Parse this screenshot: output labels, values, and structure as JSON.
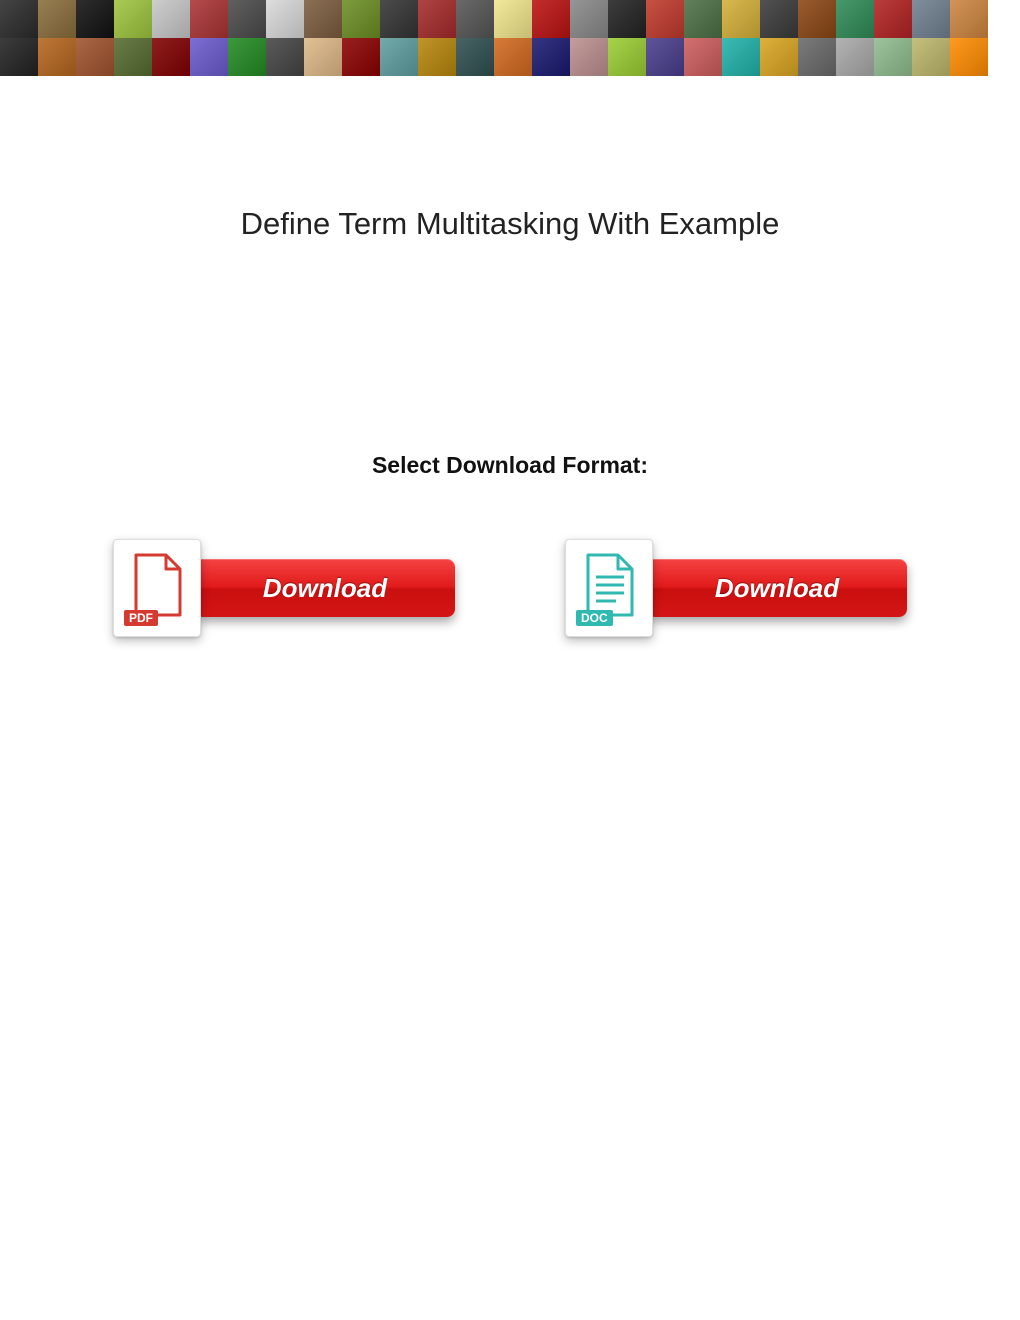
{
  "title": "Define Term Multitasking With Example",
  "select_format_label": "Select Download Format:",
  "downloads": {
    "pdf": {
      "button_label": "Download",
      "badge": "PDF"
    },
    "doc": {
      "button_label": "Download",
      "badge": "DOC"
    }
  },
  "banner_colors": [
    "#2b2b2b",
    "#8a6d3b",
    "#111",
    "#9ec53d",
    "#c7c7c7",
    "#a33",
    "#4a4a4a",
    "#d9d9d9",
    "#7b5c3e",
    "#6b8e23",
    "#333",
    "#a52a2a",
    "#555",
    "#f0e68c",
    "#b11",
    "#888",
    "#222",
    "#c0392b",
    "#4b6f44",
    "#d4af37",
    "#3a3a3a",
    "#8b4513",
    "#2e8b57",
    "#b22222",
    "#708090",
    "#cd853f",
    "#222",
    "#b5651d",
    "#a0522d",
    "#556b2f",
    "#800000",
    "#6a5acd",
    "#228b22",
    "#444",
    "#deb887",
    "#8b0000",
    "#5f9ea0",
    "#b8860b",
    "#2f4f4f",
    "#d2691e",
    "#191970",
    "#bc8f8f",
    "#9acd32",
    "#483d8b",
    "#cd5c5c",
    "#20b2aa",
    "#daa520",
    "#696969",
    "#a9a9a9",
    "#8fbc8f",
    "#bdb76b",
    "#ff8c00",
    "#9932cc",
    "#8b008b"
  ]
}
